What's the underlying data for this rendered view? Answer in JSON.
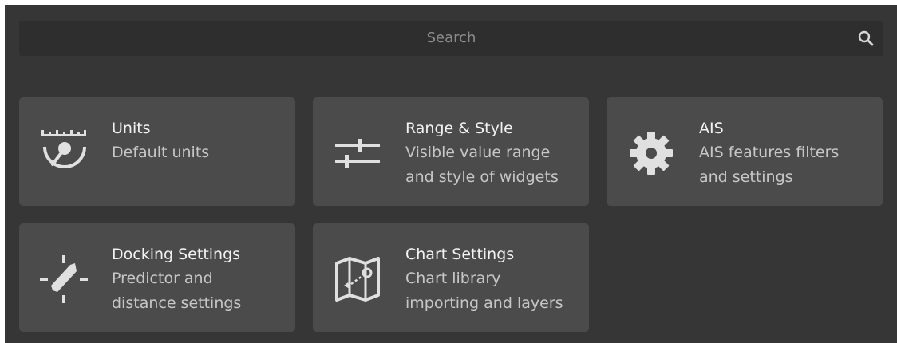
{
  "search": {
    "placeholder": "Search",
    "icon": "search-icon"
  },
  "colors": {
    "panel_background": "#363636",
    "card_background": "#4b4b4b",
    "icon_color": "#e0e0e0",
    "title_color": "#f2f2f2",
    "description_color": "#c7c7c7"
  },
  "cards": [
    {
      "title": "Units",
      "description": "Default units",
      "icon": "gauge-icon"
    },
    {
      "title": "Range & Style",
      "description": "Visible value range\nand style of widgets",
      "icon": "sliders-icon"
    },
    {
      "title": "AIS",
      "description": "AIS features filters\nand settings",
      "icon": "gear-icon"
    },
    {
      "title": "Docking Settings",
      "description": "Predictor and\ndistance settings",
      "icon": "docking-icon"
    },
    {
      "title": "Chart Settings",
      "description": "Chart library\nimporting and layers",
      "icon": "map-icon"
    }
  ]
}
